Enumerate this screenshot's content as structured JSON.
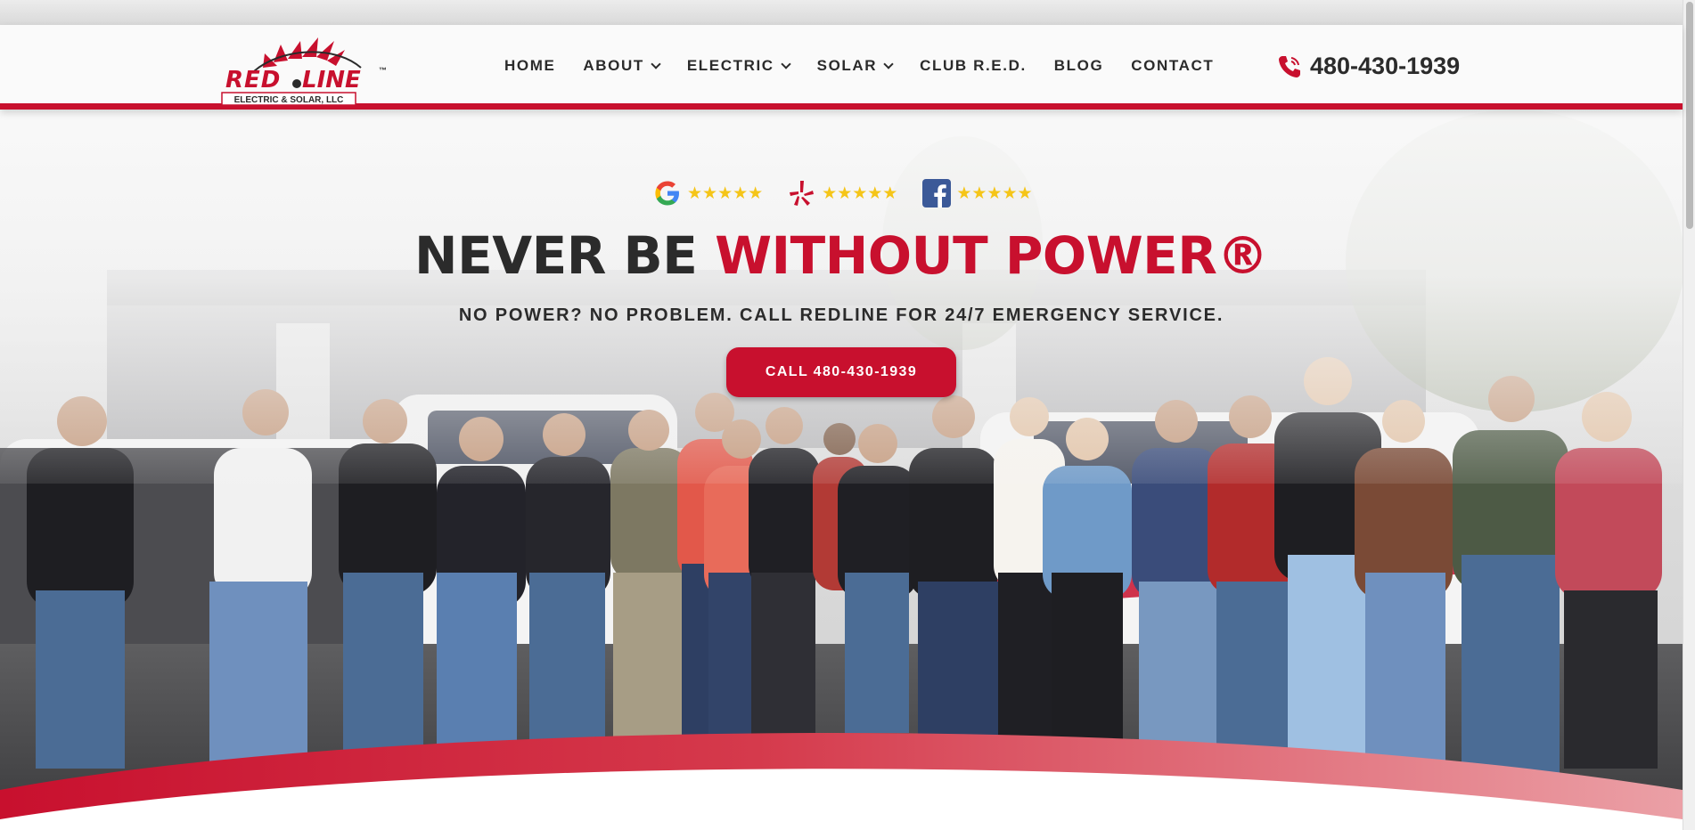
{
  "header": {
    "logo": {
      "brand_text": "REDLINE",
      "tm": "™",
      "tagline": "ELECTRIC & SOLAR, LLC"
    },
    "nav": [
      {
        "label": "HOME",
        "dropdown": false
      },
      {
        "label": "ABOUT",
        "dropdown": true
      },
      {
        "label": "ELECTRIC",
        "dropdown": true
      },
      {
        "label": "SOLAR",
        "dropdown": true
      },
      {
        "label": "CLUB R.E.D.",
        "dropdown": false
      },
      {
        "label": "BLOG",
        "dropdown": false
      },
      {
        "label": "CONTACT",
        "dropdown": false
      }
    ],
    "phone": "480-430-1939",
    "phone_icon": "phone-icon"
  },
  "hero": {
    "reviews": [
      {
        "site": "google",
        "icon": "google-icon",
        "stars": "★★★★★"
      },
      {
        "site": "yelp",
        "icon": "yelp-icon",
        "stars": "★★★★★"
      },
      {
        "site": "facebook",
        "icon": "facebook-icon",
        "stars": "★★★★★"
      }
    ],
    "headline_dark": "NEVER BE ",
    "headline_red": "WITHOUT POWER®",
    "subhead": "NO POWER? NO PROBLEM. CALL REDLINE FOR 24/7 EMERGENCY SERVICE.",
    "cta_label": "CALL 480-430-1939"
  },
  "colors": {
    "brand_red": "#c8102e",
    "text_dark": "#2b2b2b",
    "star_gold": "#f5c518"
  }
}
